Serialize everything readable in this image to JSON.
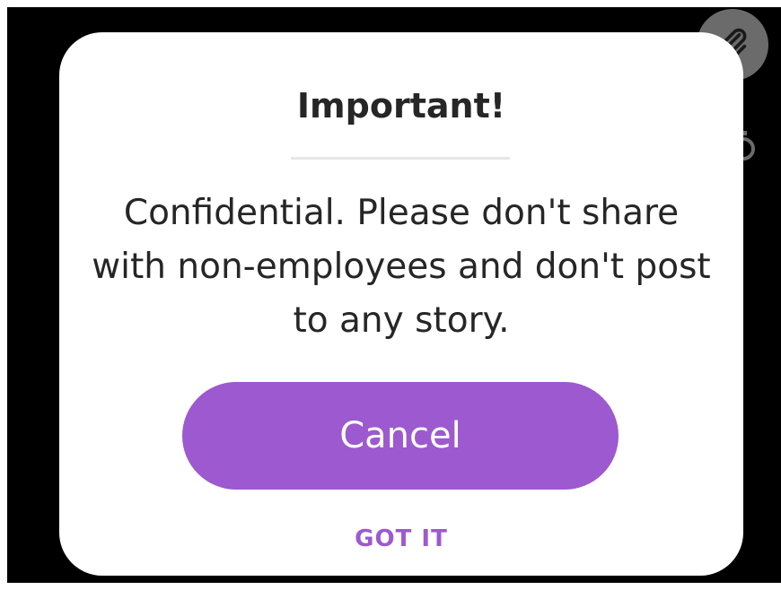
{
  "background": {
    "color": "#000000",
    "icons": [
      "paperclip-icon",
      "timer-icon"
    ]
  },
  "dialog": {
    "title": "Important!",
    "message": "Confidential. Please don't share with non-employees and don't post to any story.",
    "primary_button_label": "Cancel",
    "secondary_button_label": "GOT IT",
    "accent_color": "#9d59cf"
  }
}
